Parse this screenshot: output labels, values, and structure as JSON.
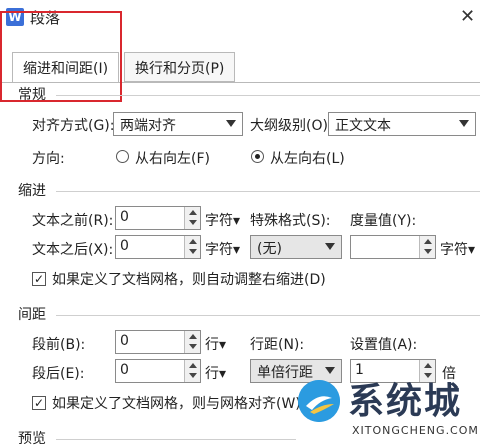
{
  "window": {
    "title": "段落",
    "app_icon": "W"
  },
  "tabs": [
    {
      "label": "缩进和间距(I)",
      "active": true
    },
    {
      "label": "换行和分页(P)",
      "active": false
    }
  ],
  "general": {
    "heading": "常规",
    "align_label": "对齐方式(G):",
    "align_value": "两端对齐",
    "outline_label": "大纲级别(O):",
    "outline_value": "正文文本",
    "direction_label": "方向:",
    "rtl_label": "从右向左(F)",
    "ltr_label": "从左向右(L)",
    "ltr_selected": true
  },
  "indent": {
    "heading": "缩进",
    "before_label": "文本之前(R):",
    "before_value": "0",
    "before_unit": "字符",
    "after_label": "文本之后(X):",
    "after_value": "0",
    "after_unit": "字符",
    "special_label": "特殊格式(S):",
    "special_value": "(无)",
    "measure_label": "度量值(Y):",
    "measure_value": "",
    "measure_unit": "字符",
    "grid_check_label": "如果定义了文档网格，则自动调整右缩进(D)",
    "grid_checked": true
  },
  "spacing": {
    "heading": "间距",
    "before_label": "段前(B):",
    "before_value": "0",
    "before_unit": "行",
    "after_label": "段后(E):",
    "after_value": "0",
    "after_unit": "行",
    "line_label": "行距(N):",
    "line_value": "单倍行距",
    "setting_label": "设置值(A):",
    "setting_value": "1",
    "setting_unit": "倍",
    "grid_check_label": "如果定义了文档网格，则与网格对齐(W)",
    "grid_checked": true
  },
  "preview": {
    "heading": "预览"
  },
  "watermark": {
    "text": "系统城",
    "sub": "XITONGCHENG.COM"
  },
  "colors": {
    "highlight_border": "#d9272e",
    "app_icon": "#3b6fd8",
    "watermark_icon": "#2b9be0"
  }
}
